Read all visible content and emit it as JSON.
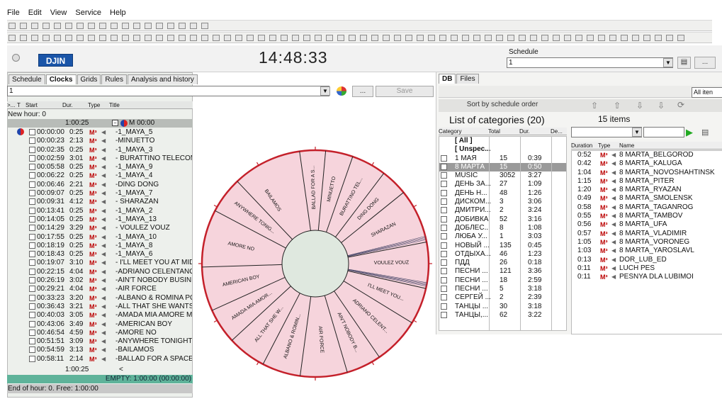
{
  "menu": [
    "File",
    "Edit",
    "View",
    "Service",
    "Help"
  ],
  "clock": "14:48:33",
  "logo": "DJIN",
  "schedule": {
    "label": "Schedule",
    "value": "1"
  },
  "left_tabs": [
    "Schedule",
    "Clocks",
    "Grids",
    "Rules",
    "Analysis and history"
  ],
  "clock_select": "1",
  "save_label": "Save",
  "more_label": "...",
  "table_headers": [
    ">...",
    "T",
    "Start",
    "Dur.",
    "Type",
    "Title"
  ],
  "new_hour": "New hour: 0",
  "group_row": {
    "dur": "1:00:25",
    "title": "M 00:00"
  },
  "tracks": [
    {
      "start": "00:00:00",
      "dur": "0:25",
      "title": "-1_MAYA_5"
    },
    {
      "start": "00:00:23",
      "dur": "2:13",
      "title": "-MINUETTO"
    },
    {
      "start": "00:02:35",
      "dur": "0:25",
      "title": "-1_MAYA_3"
    },
    {
      "start": "00:02:59",
      "dur": "3:01",
      "title": "- BURATTINO TELECOM"
    },
    {
      "start": "00:05:58",
      "dur": "0:25",
      "title": "-1_MAYA_9"
    },
    {
      "start": "00:06:22",
      "dur": "0:25",
      "title": "-1_MAYA_4"
    },
    {
      "start": "00:06:46",
      "dur": "2:21",
      "title": "-DING DONG"
    },
    {
      "start": "00:09:07",
      "dur": "0:25",
      "title": "-1_MAYA_7"
    },
    {
      "start": "00:09:31",
      "dur": "4:12",
      "title": "- SHARAZAN"
    },
    {
      "start": "00:13:41",
      "dur": "0:25",
      "title": "-1_MAYA_2"
    },
    {
      "start": "00:14:05",
      "dur": "0:25",
      "title": "-1_MAYA_13"
    },
    {
      "start": "00:14:29",
      "dur": "3:29",
      "title": "- VOULEZ VOUZ"
    },
    {
      "start": "00:17:55",
      "dur": "0:25",
      "title": "-1_MAYA_10"
    },
    {
      "start": "00:18:19",
      "dur": "0:25",
      "title": "-1_MAYA_8"
    },
    {
      "start": "00:18:43",
      "dur": "0:25",
      "title": "-1_MAYA_6"
    },
    {
      "start": "00:19:07",
      "dur": "3:10",
      "title": "- I'LL MEET YOU AT MID"
    },
    {
      "start": "00:22:15",
      "dur": "4:04",
      "title": "-ADRIANO CELENTANO"
    },
    {
      "start": "00:26:19",
      "dur": "3:02",
      "title": "-AIN'T NOBODY BUSINE"
    },
    {
      "start": "00:29:21",
      "dur": "4:04",
      "title": "-AIR FORCE"
    },
    {
      "start": "00:33:23",
      "dur": "3:20",
      "title": "-ALBANO & ROMINA PO"
    },
    {
      "start": "00:36:43",
      "dur": "3:21",
      "title": "-ALL THAT SHE WANTS"
    },
    {
      "start": "00:40:03",
      "dur": "3:05",
      "title": "-AMADA MIA AMORE M"
    },
    {
      "start": "00:43:06",
      "dur": "3:49",
      "title": "-AMERICAN BOY"
    },
    {
      "start": "00:46:54",
      "dur": "4:59",
      "title": "-AMORE NO"
    },
    {
      "start": "00:51:51",
      "dur": "3:09",
      "title": "-ANYWHERE TONIGHT"
    },
    {
      "start": "00:54:59",
      "dur": "3:13",
      "title": "-BAILAMOS"
    },
    {
      "start": "00:58:11",
      "dur": "2:14",
      "title": "-BALLAD FOR A SPACE"
    }
  ],
  "total_row": {
    "dur": "1:00:25",
    "title": "<"
  },
  "type_label": "M³",
  "empty_status": "EMPTY: 1:00:00 (00:00:00)",
  "end_status": "End of hour: 0. Free: 1:00:00",
  "wheel_labels": [
    "BALLAD FOR A S...",
    "MINUETTO",
    "BURATTINO TEL...",
    "DING DONG",
    "SHARAZAN",
    "VOULEZ VOUZ",
    "I'LL MEET YOU...",
    "ADRIANO CELENT...",
    "AIN'T NOBODY B...",
    "AIR FORCE",
    "ALBANO & ROMIN...",
    "ALL THAT SHE W...",
    "AMADA MIA AMOR...",
    "AMERICAN BOY",
    "AMORE NO",
    "ANYWHERE TONIG...",
    "BAILAMOS"
  ],
  "wheel_colors": {
    "fill": "#f6d4dc",
    "rim": "#c4202a",
    "hub": "#dfe8df",
    "line": "#222222"
  },
  "right_tabs": [
    "DB",
    "Files"
  ],
  "all_items": "All iten",
  "sort_label": "Sort by schedule order",
  "categories_title": "List of categories (20)",
  "items_title": "15 items",
  "cat_headers": [
    "Category",
    "Total",
    "Dur.",
    "De..."
  ],
  "categories": [
    {
      "name": "[ All ]",
      "total": "",
      "dur": ""
    },
    {
      "name": "[ Unspec...",
      "total": "",
      "dur": ""
    },
    {
      "name": "1 МАЯ",
      "total": "15",
      "dur": "0:39"
    },
    {
      "name": "8 МАРТА",
      "total": "15",
      "dur": "0:50"
    },
    {
      "name": "MUSIC",
      "total": "3052",
      "dur": "3:27"
    },
    {
      "name": "ДЕНЬ ЗА...",
      "total": "27",
      "dur": "1:09"
    },
    {
      "name": "ДЕНЬ Н...",
      "total": "48",
      "dur": "1:26"
    },
    {
      "name": "ДИСКОМ...",
      "total": "3",
      "dur": "3:06"
    },
    {
      "name": "ДМИТРИ...",
      "total": "2",
      "dur": "3:24"
    },
    {
      "name": "ДОБИВКА",
      "total": "52",
      "dur": "3:16"
    },
    {
      "name": "ДОБЛЕС...",
      "total": "8",
      "dur": "1:08"
    },
    {
      "name": "ЛЮБА У...",
      "total": "1",
      "dur": "3:03"
    },
    {
      "name": "НОВЫЙ ...",
      "total": "135",
      "dur": "0:45"
    },
    {
      "name": "ОТДЫХА...",
      "total": "46",
      "dur": "1:23"
    },
    {
      "name": "ПДД",
      "total": "26",
      "dur": "0:18"
    },
    {
      "name": "ПЕСНИ ...",
      "total": "121",
      "dur": "3:36"
    },
    {
      "name": "ПЕСНИ ...",
      "total": "18",
      "dur": "2:59"
    },
    {
      "name": "ПЕСНИ ...",
      "total": "5",
      "dur": "3:18"
    },
    {
      "name": "СЕРГЕЙ ...",
      "total": "2",
      "dur": "2:39"
    },
    {
      "name": "ТАНЦЫ ...",
      "total": "30",
      "dur": "3:18"
    },
    {
      "name": "ТАНЦЫ,...",
      "total": "62",
      "dur": "3:22"
    }
  ],
  "item_headers": [
    "Duration",
    "Type",
    "Name"
  ],
  "items": [
    {
      "dur": "0:52",
      "name": "8 MARTA_BELGOROD"
    },
    {
      "dur": "0:42",
      "name": "8 MARTA_KALUGA"
    },
    {
      "dur": "1:04",
      "name": "8 MARTA_NOVOSHAHTINSK"
    },
    {
      "dur": "1:15",
      "name": "8 MARTA_PITER"
    },
    {
      "dur": "1:20",
      "name": "8 MARTA_RYAZAN"
    },
    {
      "dur": "0:49",
      "name": "8 MARTA_SMOLENSK"
    },
    {
      "dur": "0:58",
      "name": "8 MARTA_TAGANROG"
    },
    {
      "dur": "0:55",
      "name": "8 MARTA_TAMBOV"
    },
    {
      "dur": "0:56",
      "name": "8 MARTA_UFA"
    },
    {
      "dur": "0:57",
      "name": "8 MARTA_VLADIMIR"
    },
    {
      "dur": "1:05",
      "name": "8 MARTA_VORONEG"
    },
    {
      "dur": "1:03",
      "name": "8 MARTA_YAROSLAVL"
    },
    {
      "dur": "0:13",
      "name": "DOR_LUB_ED"
    },
    {
      "dur": "0:11",
      "name": "LUCH PES"
    },
    {
      "dur": "0:11",
      "name": "PESNYA DLA LUBIMOI"
    }
  ]
}
